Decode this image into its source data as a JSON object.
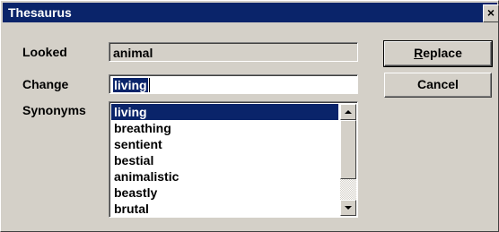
{
  "window": {
    "title": "Thesaurus",
    "close_glyph": "×"
  },
  "looked": {
    "label": "Looked",
    "value": "animal"
  },
  "change": {
    "label": "Change",
    "value": "living"
  },
  "synonyms": {
    "label": "Synonyms",
    "selected": "living",
    "items": [
      "living",
      "breathing",
      "sentient",
      "bestial",
      "animalistic",
      "beastly",
      "brutal"
    ]
  },
  "buttons": {
    "replace_mnemonic": "R",
    "replace_rest": "eplace",
    "cancel": "Cancel"
  },
  "colors": {
    "titlebar": "#0a246a",
    "face": "#d4d0c8",
    "selection": "#0a246a"
  }
}
